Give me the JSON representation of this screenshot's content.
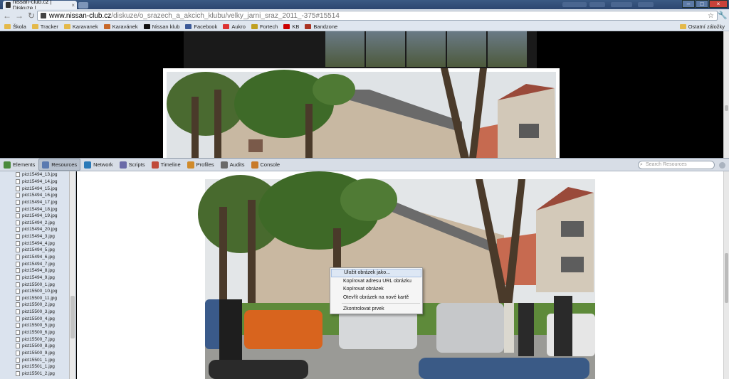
{
  "browser": {
    "tab_title": "nissan-club.cz | Diskuze | ...",
    "tab_close": "×",
    "url_host": "www.nissan-club.cz",
    "url_path": "/diskuze/o_srazech_a_akcich_klubu/velky_jarni_sraz_2011_-375#15514",
    "window_buttons": [
      "–",
      "□",
      "×"
    ]
  },
  "bookmarks": {
    "items": [
      {
        "label": "Škola",
        "icon": "folder-icon"
      },
      {
        "label": "Tracker",
        "icon": "folder-icon"
      },
      {
        "label": "Karavanek",
        "icon": "folder-icon"
      },
      {
        "label": "Karavánek",
        "icon": "site-icon"
      },
      {
        "label": "Nissan klub",
        "icon": "site-icon"
      },
      {
        "label": "Facebook",
        "icon": "facebook-icon"
      },
      {
        "label": "Aukro",
        "icon": "site-icon"
      },
      {
        "label": "Fortech",
        "icon": "site-icon"
      },
      {
        "label": "KB",
        "icon": "site-icon"
      },
      {
        "label": "Bandzone",
        "icon": "site-icon"
      }
    ],
    "other": "Ostatní záložky"
  },
  "devtools": {
    "tabs": [
      "Elements",
      "Resources",
      "Network",
      "Scripts",
      "Timeline",
      "Profiles",
      "Audits",
      "Console"
    ],
    "active_tab": "Resources",
    "search_placeholder": "Search Resources"
  },
  "resources": {
    "files": [
      "pict15494_13.jpg",
      "pict15494_14.jpg",
      "pict15494_15.jpg",
      "pict15494_16.jpg",
      "pict15494_17.jpg",
      "pict15494_18.jpg",
      "pict15494_19.jpg",
      "pict15494_2.jpg",
      "pict15494_20.jpg",
      "pict15494_3.jpg",
      "pict15494_4.jpg",
      "pict15494_5.jpg",
      "pict15494_6.jpg",
      "pict15494_7.jpg",
      "pict15494_8.jpg",
      "pict15494_9.jpg",
      "pict15500_1.jpg",
      "pict15500_10.jpg",
      "pict15500_11.jpg",
      "pict15500_2.jpg",
      "pict15500_3.jpg",
      "pict15500_4.jpg",
      "pict15500_5.jpg",
      "pict15500_6.jpg",
      "pict15500_7.jpg",
      "pict15500_8.jpg",
      "pict15500_9.jpg",
      "pict15501_1.jpg",
      "pict15501_1.jpg",
      "pict15501_2.jpg"
    ]
  },
  "context_menu": {
    "items": [
      "Uložit obrázek jako...",
      "Kopírovat adresu URL obrázku",
      "Kopírovat obrázek",
      "Otevřít obrázek na nové kartě",
      "Zkontrolovat prvek"
    ]
  }
}
